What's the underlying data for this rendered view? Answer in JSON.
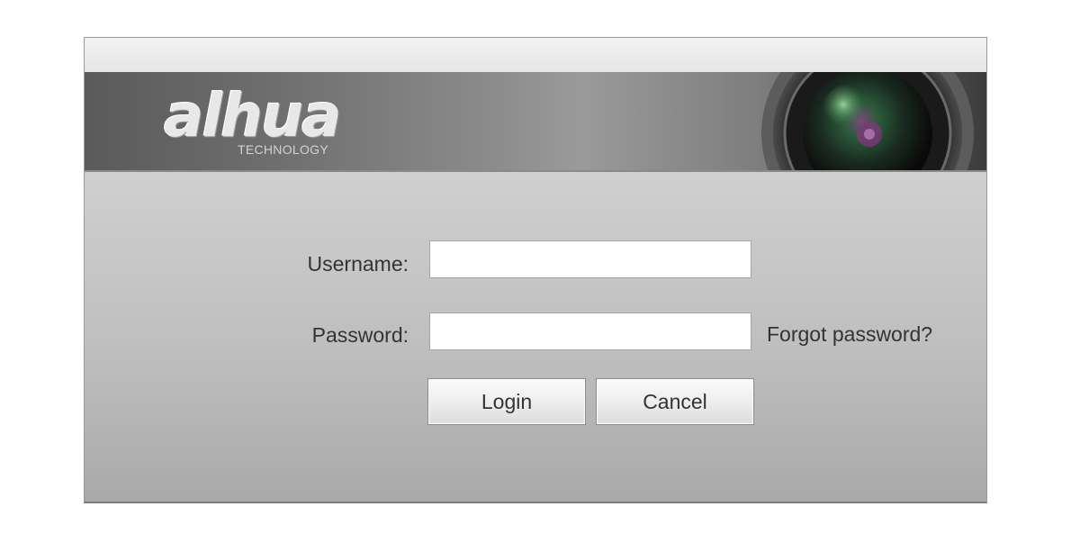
{
  "brand": {
    "logo_text": "alhua",
    "logo_subtitle": "TECHNOLOGY"
  },
  "form": {
    "username_label": "Username:",
    "username_value": "",
    "password_label": "Password:",
    "password_value": "",
    "forgot_password_link": "Forgot password?",
    "login_button": "Login",
    "cancel_button": "Cancel"
  }
}
